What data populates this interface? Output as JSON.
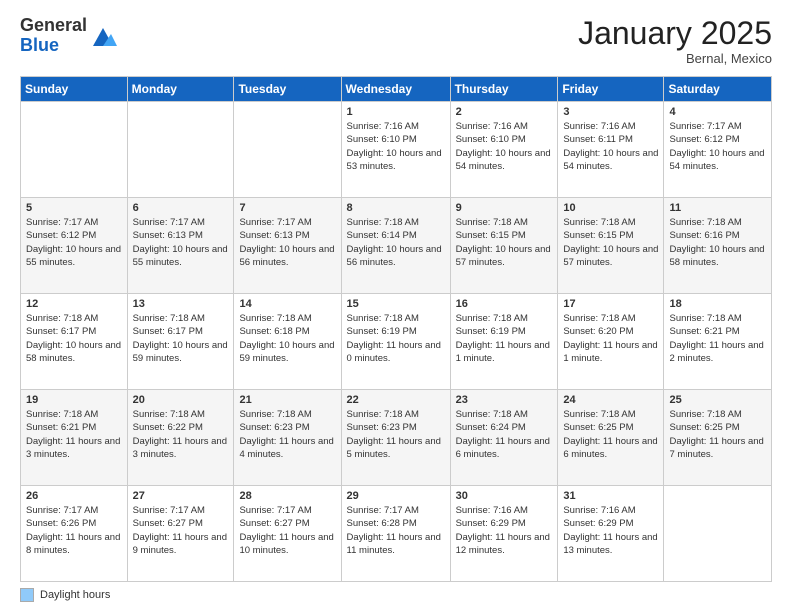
{
  "logo": {
    "line1": "General",
    "line2": "Blue"
  },
  "title": "January 2025",
  "subtitle": "Bernal, Mexico",
  "days_header": [
    "Sunday",
    "Monday",
    "Tuesday",
    "Wednesday",
    "Thursday",
    "Friday",
    "Saturday"
  ],
  "footer": {
    "swatch_label": "Daylight hours"
  },
  "weeks": [
    [
      {
        "num": "",
        "info": ""
      },
      {
        "num": "",
        "info": ""
      },
      {
        "num": "",
        "info": ""
      },
      {
        "num": "1",
        "info": "Sunrise: 7:16 AM\nSunset: 6:10 PM\nDaylight: 10 hours and 53 minutes."
      },
      {
        "num": "2",
        "info": "Sunrise: 7:16 AM\nSunset: 6:10 PM\nDaylight: 10 hours and 54 minutes."
      },
      {
        "num": "3",
        "info": "Sunrise: 7:16 AM\nSunset: 6:11 PM\nDaylight: 10 hours and 54 minutes."
      },
      {
        "num": "4",
        "info": "Sunrise: 7:17 AM\nSunset: 6:12 PM\nDaylight: 10 hours and 54 minutes."
      }
    ],
    [
      {
        "num": "5",
        "info": "Sunrise: 7:17 AM\nSunset: 6:12 PM\nDaylight: 10 hours and 55 minutes."
      },
      {
        "num": "6",
        "info": "Sunrise: 7:17 AM\nSunset: 6:13 PM\nDaylight: 10 hours and 55 minutes."
      },
      {
        "num": "7",
        "info": "Sunrise: 7:17 AM\nSunset: 6:13 PM\nDaylight: 10 hours and 56 minutes."
      },
      {
        "num": "8",
        "info": "Sunrise: 7:18 AM\nSunset: 6:14 PM\nDaylight: 10 hours and 56 minutes."
      },
      {
        "num": "9",
        "info": "Sunrise: 7:18 AM\nSunset: 6:15 PM\nDaylight: 10 hours and 57 minutes."
      },
      {
        "num": "10",
        "info": "Sunrise: 7:18 AM\nSunset: 6:15 PM\nDaylight: 10 hours and 57 minutes."
      },
      {
        "num": "11",
        "info": "Sunrise: 7:18 AM\nSunset: 6:16 PM\nDaylight: 10 hours and 58 minutes."
      }
    ],
    [
      {
        "num": "12",
        "info": "Sunrise: 7:18 AM\nSunset: 6:17 PM\nDaylight: 10 hours and 58 minutes."
      },
      {
        "num": "13",
        "info": "Sunrise: 7:18 AM\nSunset: 6:17 PM\nDaylight: 10 hours and 59 minutes."
      },
      {
        "num": "14",
        "info": "Sunrise: 7:18 AM\nSunset: 6:18 PM\nDaylight: 10 hours and 59 minutes."
      },
      {
        "num": "15",
        "info": "Sunrise: 7:18 AM\nSunset: 6:19 PM\nDaylight: 11 hours and 0 minutes."
      },
      {
        "num": "16",
        "info": "Sunrise: 7:18 AM\nSunset: 6:19 PM\nDaylight: 11 hours and 1 minute."
      },
      {
        "num": "17",
        "info": "Sunrise: 7:18 AM\nSunset: 6:20 PM\nDaylight: 11 hours and 1 minute."
      },
      {
        "num": "18",
        "info": "Sunrise: 7:18 AM\nSunset: 6:21 PM\nDaylight: 11 hours and 2 minutes."
      }
    ],
    [
      {
        "num": "19",
        "info": "Sunrise: 7:18 AM\nSunset: 6:21 PM\nDaylight: 11 hours and 3 minutes."
      },
      {
        "num": "20",
        "info": "Sunrise: 7:18 AM\nSunset: 6:22 PM\nDaylight: 11 hours and 3 minutes."
      },
      {
        "num": "21",
        "info": "Sunrise: 7:18 AM\nSunset: 6:23 PM\nDaylight: 11 hours and 4 minutes."
      },
      {
        "num": "22",
        "info": "Sunrise: 7:18 AM\nSunset: 6:23 PM\nDaylight: 11 hours and 5 minutes."
      },
      {
        "num": "23",
        "info": "Sunrise: 7:18 AM\nSunset: 6:24 PM\nDaylight: 11 hours and 6 minutes."
      },
      {
        "num": "24",
        "info": "Sunrise: 7:18 AM\nSunset: 6:25 PM\nDaylight: 11 hours and 6 minutes."
      },
      {
        "num": "25",
        "info": "Sunrise: 7:18 AM\nSunset: 6:25 PM\nDaylight: 11 hours and 7 minutes."
      }
    ],
    [
      {
        "num": "26",
        "info": "Sunrise: 7:17 AM\nSunset: 6:26 PM\nDaylight: 11 hours and 8 minutes."
      },
      {
        "num": "27",
        "info": "Sunrise: 7:17 AM\nSunset: 6:27 PM\nDaylight: 11 hours and 9 minutes."
      },
      {
        "num": "28",
        "info": "Sunrise: 7:17 AM\nSunset: 6:27 PM\nDaylight: 11 hours and 10 minutes."
      },
      {
        "num": "29",
        "info": "Sunrise: 7:17 AM\nSunset: 6:28 PM\nDaylight: 11 hours and 11 minutes."
      },
      {
        "num": "30",
        "info": "Sunrise: 7:16 AM\nSunset: 6:29 PM\nDaylight: 11 hours and 12 minutes."
      },
      {
        "num": "31",
        "info": "Sunrise: 7:16 AM\nSunset: 6:29 PM\nDaylight: 11 hours and 13 minutes."
      },
      {
        "num": "",
        "info": ""
      }
    ]
  ]
}
